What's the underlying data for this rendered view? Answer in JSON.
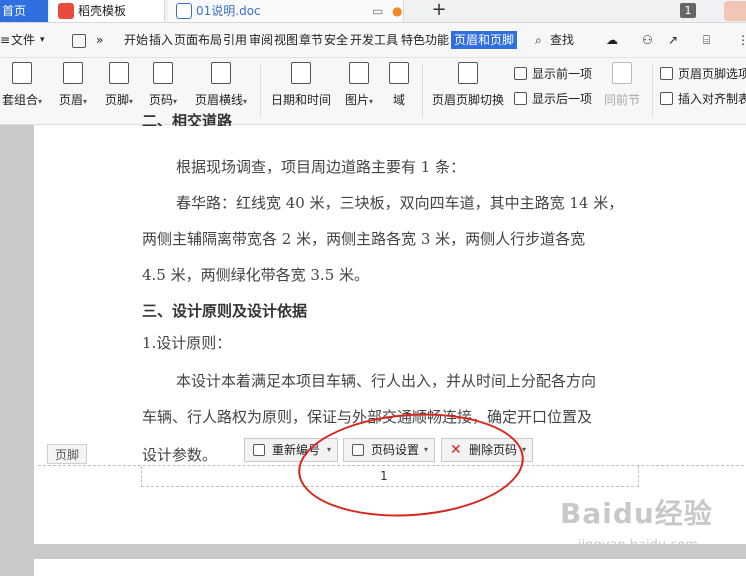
{
  "tabs": {
    "home": "首页",
    "template": "稻壳模板",
    "document": "01说明.doc",
    "new_tab": "+",
    "window_count": "1"
  },
  "menu": {
    "file": "文件",
    "more": "»",
    "items": [
      "开始",
      "插入",
      "页面布局",
      "引用",
      "审阅",
      "视图",
      "章节",
      "安全",
      "开发工具",
      "特色功能"
    ],
    "active": "页眉和页脚",
    "search": "查找"
  },
  "ribbon": {
    "set_group": "套组合",
    "header": "页眉",
    "footer": "页脚",
    "page_number": "页码",
    "header_line": "页眉横线",
    "date_time": "日期和时间",
    "picture": "图片",
    "field": "域",
    "switch_header_footer": "页眉页脚切换",
    "show_previous": "显示前一项",
    "show_next": "显示后一项",
    "same_as_previous": "同前节",
    "header_footer_options": "页眉页脚选项",
    "insert_align_tab": "插入对齐制表"
  },
  "document": {
    "heading_cut": "二、相交道路",
    "p1": "根据现场调查，项目周边道路主要有 1 条：",
    "p2_line1": "春华路：红线宽 40 米，三块板，双向四车道，其中主路宽 14 米，",
    "p2_line2": "两侧主辅隔离带宽各 2 米，两侧主路各宽 3 米，两侧人行步道各宽",
    "p2_line3": "4.5 米，两侧绿化带各宽 3.5 米。",
    "heading3": "三、设计原则及设计依据",
    "sub1": "1.设计原则：",
    "p3_line1": "本设计本着满足本项目车辆、行人出入，并从时间上分配各方向",
    "p3_line2": "车辆、行人路权为原则，保证与外部交通顺畅连接，确定开口位置及",
    "p3_line3": "设计参数。"
  },
  "footer": {
    "label": "页脚",
    "renumber": "重新编号",
    "page_setup": "页码设置",
    "delete_page_number": "删除页码",
    "page_number_value": "1"
  },
  "watermark": {
    "brand": "Baidu经验",
    "url": "jingyan.baidu.com"
  },
  "colors": {
    "accent": "#2f6fe0",
    "annotation": "#d8251c"
  }
}
